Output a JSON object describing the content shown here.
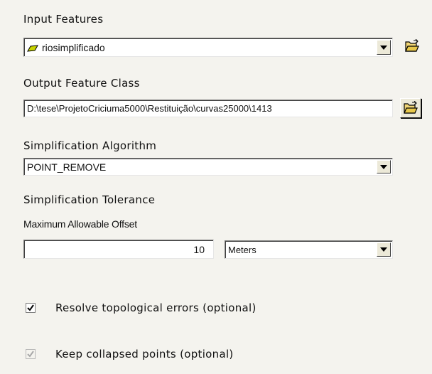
{
  "input_features": {
    "label": "Input Features",
    "value": "riosimplificado",
    "icon": "polyline-layer-icon"
  },
  "output_feature_class": {
    "label": "Output Feature Class",
    "value": "D:\\tese\\ProjetoCriciuma5000\\Restituição\\curvas25000\\1413"
  },
  "simplification_algorithm": {
    "label": "Simplification Algorithm",
    "value": "POINT_REMOVE"
  },
  "simplification_tolerance": {
    "label": "Simplification Tolerance",
    "sub_label": "Maximum Allowable Offset",
    "value": "10",
    "unit": "Meters"
  },
  "resolve_topological_errors": {
    "label": "Resolve topological errors (optional)",
    "checked": true,
    "enabled": true
  },
  "keep_collapsed_points": {
    "label": "Keep collapsed points (optional)",
    "checked": true,
    "enabled": false
  },
  "colors": {
    "background": "#f4f3ee",
    "folder_yellow": "#e8c84a",
    "layer_icon": "#c8d400"
  }
}
